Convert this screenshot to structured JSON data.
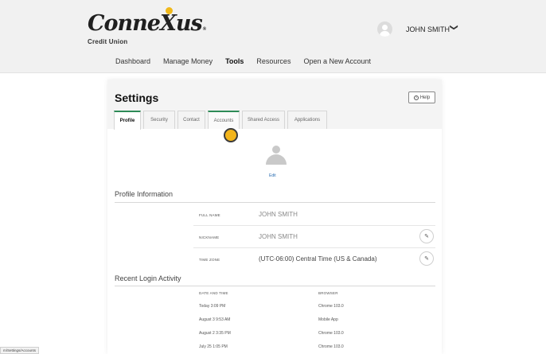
{
  "brand": {
    "logo_word_a": "Conne",
    "logo_word_x": "X",
    "logo_word_b": "us",
    "logo_sub": "Credit Union",
    "logo_reg": "®"
  },
  "user": {
    "name": "JOHN SMITH",
    "chevron": "❯"
  },
  "nav": {
    "items": [
      "Dashboard",
      "Manage Money",
      "Tools",
      "Resources",
      "Open a New Account"
    ],
    "active": "Tools"
  },
  "settings": {
    "title": "Settings",
    "help_label": "Help",
    "tabs": [
      "Profile",
      "Security",
      "Contact",
      "Accounts",
      "Shared Access",
      "Applications"
    ],
    "active_tab": "Profile",
    "edit_label": "Edit"
  },
  "profile": {
    "heading": "Profile Information",
    "rows": [
      {
        "label": "FULL NAME",
        "value": "JOHN SMITH"
      },
      {
        "label": "NICKNAME",
        "value": "JOHN SMITH"
      },
      {
        "label": "TIME ZONE",
        "value": "(UTC-06:00) Central Time (US & Canada)"
      }
    ]
  },
  "login": {
    "heading": "Recent Login Activity",
    "col_date": "DATE AND TIME",
    "col_browser": "BROWSER",
    "rows": [
      {
        "date": "Today 3:09 PM",
        "browser": "Chrome 103.0"
      },
      {
        "date": "August 3 9:53 AM",
        "browser": "Mobile App"
      },
      {
        "date": "August 2 3:35 PM",
        "browser": "Chrome 103.0"
      },
      {
        "date": "July 25 1:05 PM",
        "browser": "Chrome 103.0"
      }
    ]
  },
  "status_url": "m/Settings/Accounts",
  "colors": {
    "accent": "#2e8b57",
    "logo_dot": "#f0b81a",
    "link": "#2a6db2",
    "cursor": "#f3b51c"
  }
}
